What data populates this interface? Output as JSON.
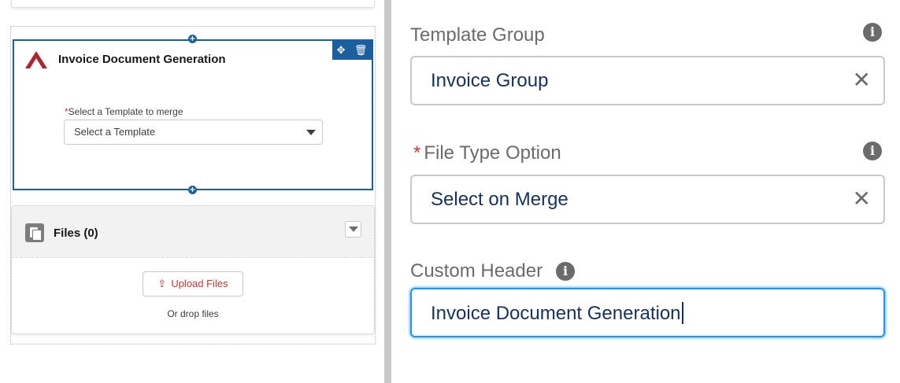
{
  "canvas": {
    "component": {
      "title": "Invoice Document Generation",
      "template_label": "Select a Template to merge",
      "template_required_marker": "*",
      "template_placeholder": "Select a Template",
      "toolbar_icons": [
        "move-icon",
        "trash-icon"
      ]
    },
    "files": {
      "title": "Files (0)",
      "upload_label": "Upload Files",
      "drop_text": "Or drop files"
    }
  },
  "panel": {
    "fields": [
      {
        "label": "Template Group",
        "required": false,
        "value": "Invoice Group",
        "clearable": true
      },
      {
        "label": "File Type Option",
        "required": true,
        "value": "Select on Merge",
        "clearable": true
      },
      {
        "label": "Custom Header",
        "required": false,
        "value": "Invoice Document Generation",
        "clearable": false,
        "focused": true
      }
    ],
    "required_marker": "*"
  },
  "colors": {
    "brand_blue": "#1b5f9e",
    "focus_blue": "#1b96ff",
    "required_red": "#c23934",
    "logo_red": "#b0242f",
    "value_navy": "#16325c"
  }
}
